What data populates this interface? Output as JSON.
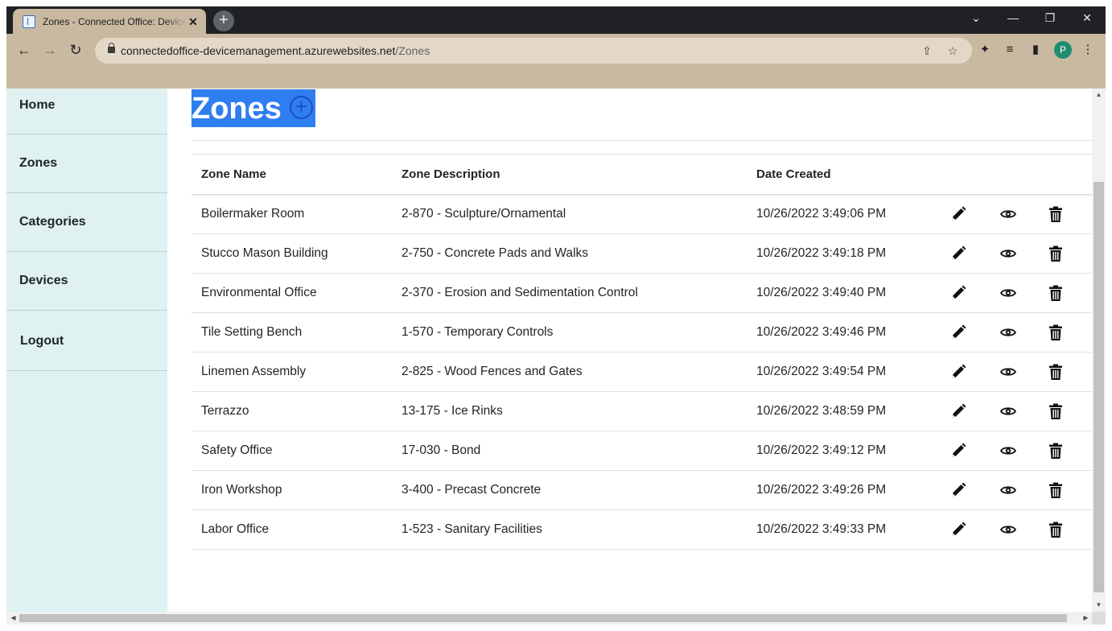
{
  "browser": {
    "tab_title": "Zones - Connected Office: Device Management",
    "new_tab": "+",
    "url_host": "connectedoffice-devicemanagement.azurewebsites.net",
    "url_path": "/Zones",
    "profile_initial": "P"
  },
  "sidebar": {
    "items": [
      {
        "label": "Home"
      },
      {
        "label": "Zones"
      },
      {
        "label": "Categories"
      },
      {
        "label": "Devices"
      },
      {
        "label": "Logout"
      }
    ]
  },
  "page": {
    "title": "Zones",
    "add_icon": "plus-circle-icon"
  },
  "table": {
    "headers": [
      "Zone Name",
      "Zone Description",
      "Date Created"
    ],
    "rows": [
      {
        "name": "Boilermaker Room",
        "description": "2-870 - Sculpture/Ornamental",
        "date": "10/26/2022 3:49:06 PM"
      },
      {
        "name": "Stucco Mason Building",
        "description": "2-750 - Concrete Pads and Walks",
        "date": "10/26/2022 3:49:18 PM"
      },
      {
        "name": "Environmental Office",
        "description": "2-370 - Erosion and Sedimentation Control",
        "date": "10/26/2022 3:49:40 PM"
      },
      {
        "name": "Tile Setting Bench",
        "description": "1-570 - Temporary Controls",
        "date": "10/26/2022 3:49:46 PM"
      },
      {
        "name": "Linemen Assembly",
        "description": "2-825 - Wood Fences and Gates",
        "date": "10/26/2022 3:49:54 PM"
      },
      {
        "name": "Terrazzo",
        "description": "13-175 - Ice Rinks",
        "date": "10/26/2022 3:48:59 PM"
      },
      {
        "name": "Safety Office",
        "description": "17-030 - Bond",
        "date": "10/26/2022 3:49:12 PM"
      },
      {
        "name": "Iron Workshop",
        "description": "3-400 - Precast Concrete",
        "date": "10/26/2022 3:49:26 PM"
      },
      {
        "name": "Labor Office",
        "description": "1-523 - Sanitary Facilities",
        "date": "10/26/2022 3:49:33 PM"
      }
    ]
  },
  "colors": {
    "sidebar_bg": "#dff2f1",
    "link": "#1f66c6",
    "chrome": "#c9b9a0",
    "selection": "#2f7ef0"
  }
}
